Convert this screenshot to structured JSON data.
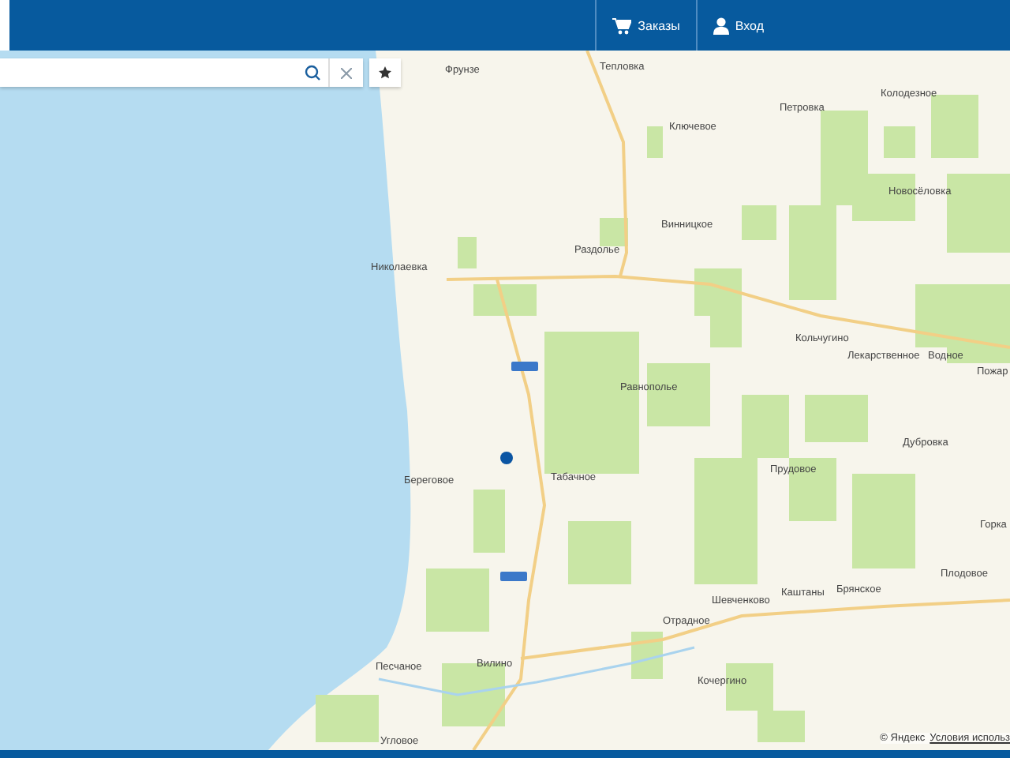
{
  "header": {
    "buttons": [
      {
        "kind": "cart",
        "label": "Заказы"
      },
      {
        "kind": "user",
        "label": "Вход"
      }
    ]
  },
  "map": {
    "places": [
      {
        "name": "Фрунзе"
      },
      {
        "name": "Тепловка"
      },
      {
        "name": "Петровка"
      },
      {
        "name": "Колодезное"
      },
      {
        "name": "Ключевое"
      },
      {
        "name": "Новосёловка"
      },
      {
        "name": "Винницкое"
      },
      {
        "name": "Раздолье"
      },
      {
        "name": "Николаевка"
      },
      {
        "name": "Кольчугино"
      },
      {
        "name": "Лекарственное"
      },
      {
        "name": "Водное"
      },
      {
        "name": "Пожар"
      },
      {
        "name": "Равнополье"
      },
      {
        "name": "Дубровка"
      },
      {
        "name": "Прудовое"
      },
      {
        "name": "Береговое"
      },
      {
        "name": "Табачное"
      },
      {
        "name": "Горка"
      },
      {
        "name": "Плодовое"
      },
      {
        "name": "Шевченково"
      },
      {
        "name": "Каштаны"
      },
      {
        "name": "Брянское"
      },
      {
        "name": "Отрадное"
      },
      {
        "name": "Вилино"
      },
      {
        "name": "Песчаное"
      },
      {
        "name": "Кочергино"
      },
      {
        "name": "Угловое"
      }
    ],
    "copyright": "© Яндекс",
    "terms_link": "Условия использ"
  }
}
